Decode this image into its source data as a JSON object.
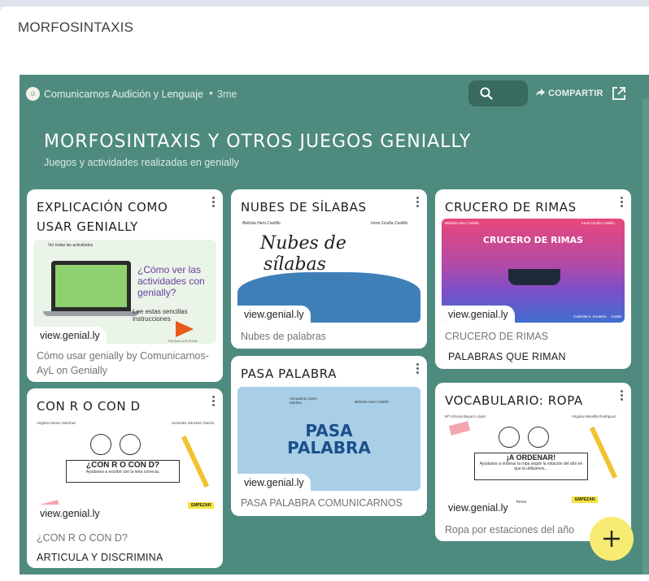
{
  "page": {
    "title": "MORFOSINTAXIS"
  },
  "padlet": {
    "author": "Comunicarnos Audición y Lenguaje",
    "age": "3me",
    "share_label": "COMPARTIR",
    "title": "MORFOSINTAXIS Y OTROS JUEGOS GENIALLY",
    "subtitle": "Juegos y actividades realizadas en genially"
  },
  "cards": [
    {
      "title": "EXPLICACIÓN COMO USAR GENIALLY",
      "link": "view.genial.ly",
      "caption": "Cómo usar genially by Comunicarnos-AyL on Genially",
      "body": "",
      "thumb": {
        "top_label": "Ver todas las actividades",
        "heading": "¿Cómo ver las actividades con genially?",
        "sub": "Lee estas sencillas instrucciones",
        "hint": "PULSA LA FLECHA"
      }
    },
    {
      "title": "CON R O CON D",
      "link": "view.genial.ly",
      "caption": "¿CON R O CON D?",
      "body": "ARTICULA Y DISCRIMINA",
      "thumb": {
        "left_author": "Virginia Alonso Sánchez",
        "right_author": "Sonsoles Sánchez García",
        "heading": "¿CON R O CON D?",
        "sub": "Ayúdanos a escribir con la letra correcta.",
        "button": "EMPEZAR"
      }
    },
    {
      "title": "NUBES DE SÍLABAS",
      "link": "view.genial.ly",
      "caption": "Nubes de palabras",
      "body": "",
      "thumb": {
        "left_author": "Belinda Haro Castillo",
        "right_author": "Irene Ocaña Castillo",
        "heading_line1": "Nubes de",
        "heading_line2": "sílabas"
      }
    },
    {
      "title": "PASA PALABRA",
      "link": "view.genial.ly",
      "caption": "PASA PALABRA COMUNICARNOS",
      "body": "",
      "thumb": {
        "left_author": "Almudena López Medina",
        "right_author": "Belinda Haro Castillo",
        "heading_line1": "PASA",
        "heading_line2": "PALABRA"
      }
    },
    {
      "title": "CRUCERO DE RIMAS",
      "link": "view.genial.ly",
      "caption": "CRUCERO DE RIMAS",
      "body": "PALABRAS QUE RIMAN",
      "thumb": {
        "left_author": "Belinda Haro Castillo",
        "right_author": "Irene Ocaña Castillo",
        "heading": "CRUCERO DE RIMAS",
        "lang1": "Castellano",
        "lang2": "Euskera",
        "lang3": "Català"
      }
    },
    {
      "title": "VOCABULARIO: ROPA",
      "link": "view.genial.ly",
      "caption": "Ropa por estaciones del año",
      "body": "",
      "thumb": {
        "left_author": "Mª Victoria Bayarri López",
        "right_author": "Virginia Mansilla Rodríguez",
        "heading": "¡A ORDENAR!",
        "sub": "Ayúdanos a ordenar la ropa según la estación del año en que la utilizamos...",
        "button": "EMPEZAR",
        "chip": "fonos"
      }
    }
  ],
  "colors": {
    "board_bg": "#4e8b7e",
    "card_bg": "#ffffff",
    "fab_bg": "#f6ec73"
  },
  "icons": {
    "search": "search-icon",
    "share": "share-arrow-icon",
    "open": "open-in-new-icon",
    "add": "plus-icon",
    "menu": "more-vert-icon"
  }
}
